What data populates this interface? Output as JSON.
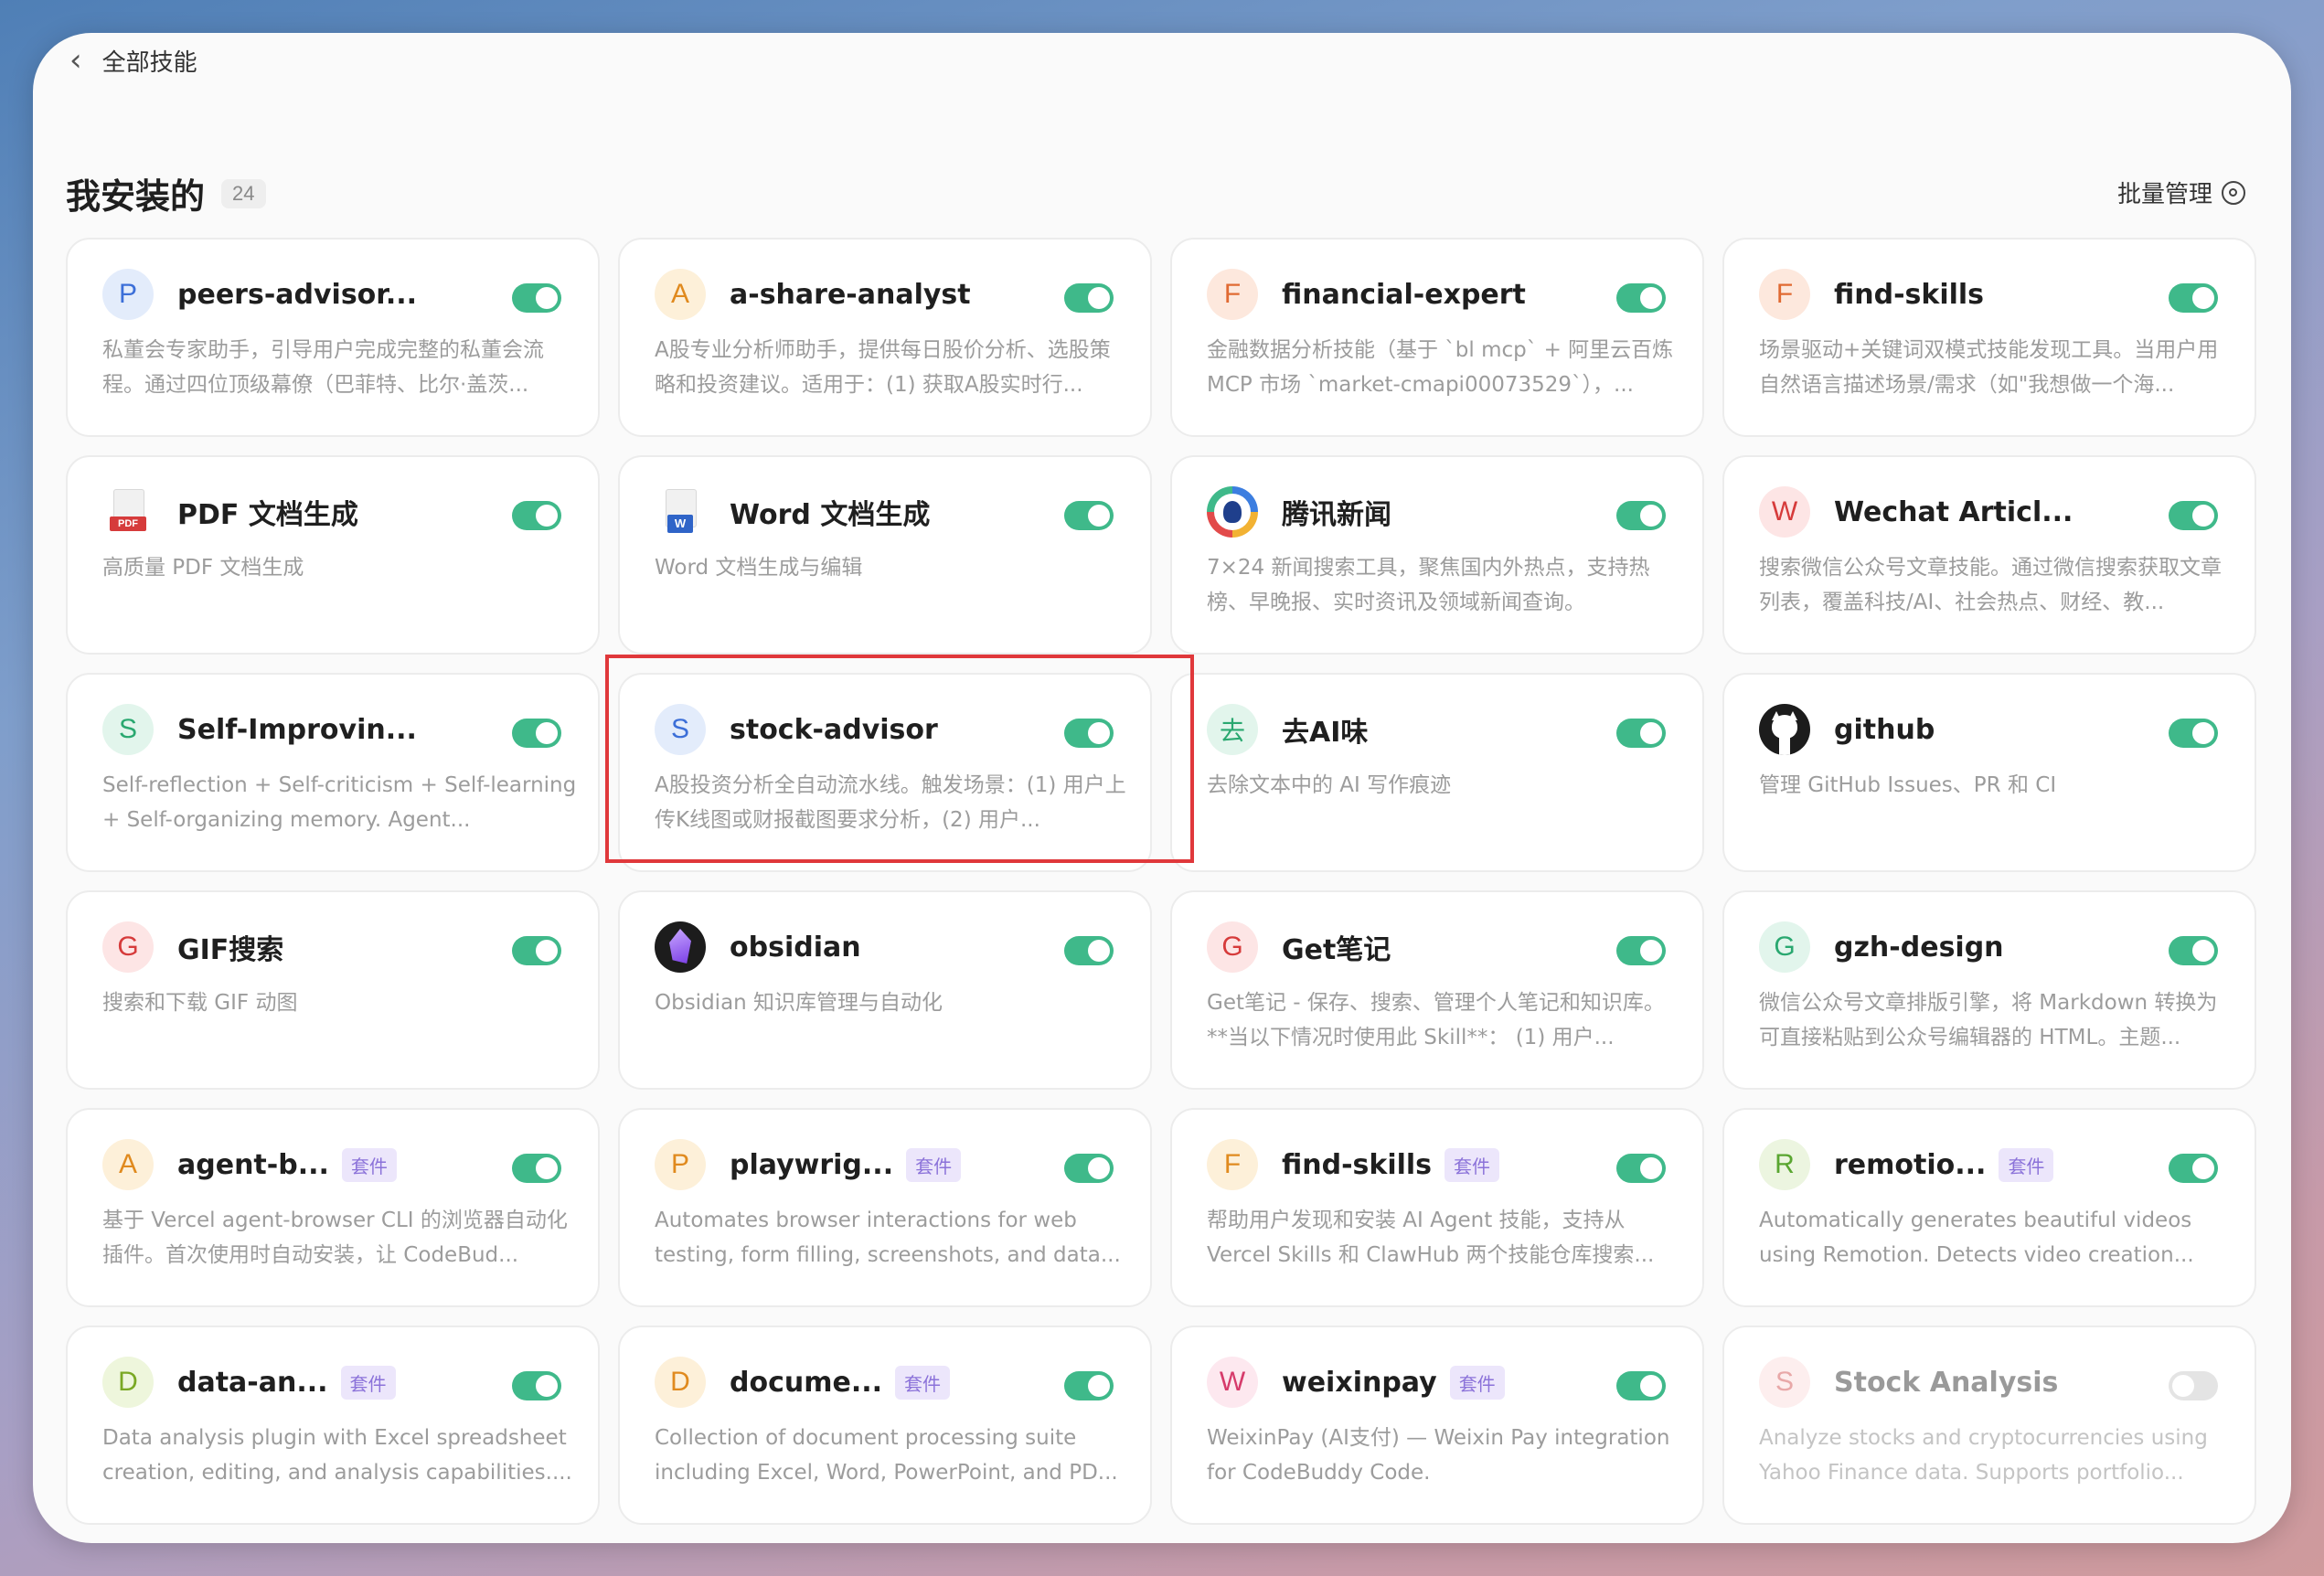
{
  "header": {
    "back_label": "全部技能",
    "section_title": "我安装的",
    "count": "24",
    "batch_label": "批量管理"
  },
  "colors": {
    "toggle_on": "#3fb98a",
    "toggle_off": "#e4e4e4",
    "kit_badge_bg": "#ece6fb",
    "kit_badge_text": "#8b72d9",
    "highlight": "#e0383b"
  },
  "kit_label": "套件",
  "skills": [
    {
      "name": "peers-advisor...",
      "icon": "P",
      "desc": "私董会专家助手，引导用户完成完整的私董会流程。通过四位顶级幕僚（巴菲特、比尔·盖茨...",
      "enabled": true
    },
    {
      "name": "a-share-analyst",
      "icon": "A",
      "desc": "A股专业分析师助手，提供每日股价分析、选股策略和投资建议。适用于：(1) 获取A股实时行...",
      "enabled": true
    },
    {
      "name": "financial-expert",
      "icon": "F",
      "desc": "金融数据分析技能（基于 `bl mcp` + 阿里云百炼 MCP 市场 `market-cmapi00073529`），...",
      "enabled": true
    },
    {
      "name": "find-skills",
      "icon": "F",
      "desc": "场景驱动+关键词双模式技能发现工具。当用户用自然语言描述场景/需求（如\"我想做一个海...",
      "enabled": true
    },
    {
      "name": "PDF 文档生成",
      "icon": "pdf-icon",
      "icon_text": "PDF",
      "desc": "高质量 PDF 文档生成",
      "enabled": true
    },
    {
      "name": "Word 文档生成",
      "icon": "word-icon",
      "icon_text": "W",
      "desc": "Word 文档生成与编辑",
      "enabled": true
    },
    {
      "name": "腾讯新闻",
      "icon": "tencent-news-icon",
      "desc": "7×24 新闻搜索工具，聚焦国内外热点，支持热榜、早晚报、实时资讯及领域新闻查询。",
      "enabled": true
    },
    {
      "name": "Wechat Articl...",
      "icon": "W",
      "desc": "搜索微信公众号文章技能。通过微信搜索获取文章列表，覆盖科技/AI、社会热点、财经、教...",
      "enabled": true
    },
    {
      "name": "Self-Improvin...",
      "icon": "S",
      "desc": "Self-reflection + Self-criticism + Self-learning + Self-organizing memory. Agent...",
      "enabled": true
    },
    {
      "name": "stock-advisor",
      "icon": "S",
      "desc": "A股投资分析全自动流水线。触发场景：(1) 用户上传K线图或财报截图要求分析，(2) 用户...",
      "enabled": true
    },
    {
      "name": "去AI味",
      "icon": "去",
      "desc": "去除文本中的 AI 写作痕迹",
      "enabled": true
    },
    {
      "name": "github",
      "icon": "github-icon",
      "desc": "管理 GitHub Issues、PR 和 CI",
      "enabled": true
    },
    {
      "name": "GIF搜索",
      "icon": "G",
      "desc": "搜索和下载 GIF 动图",
      "enabled": true
    },
    {
      "name": "obsidian",
      "icon": "obsidian-icon",
      "desc": "Obsidian 知识库管理与自动化",
      "enabled": true
    },
    {
      "name": "Get笔记",
      "icon": "G",
      "desc": "Get笔记 - 保存、搜索、管理个人笔记和知识库。 **当以下情况时使用此 Skill**： (1) 用户...",
      "enabled": true
    },
    {
      "name": "gzh-design",
      "icon": "G",
      "desc": "微信公众号文章排版引擎，将 Markdown 转换为可直接粘贴到公众号编辑器的 HTML。主题...",
      "enabled": true
    },
    {
      "name": "agent-b...",
      "icon": "A",
      "kit": true,
      "desc": "基于 Vercel agent-browser CLI 的浏览器自动化插件。首次使用时自动安装，让 CodeBud...",
      "enabled": true
    },
    {
      "name": "playwrig...",
      "icon": "P",
      "kit": true,
      "desc": "Automates browser interactions for web testing, form filling, screenshots, and data...",
      "enabled": true
    },
    {
      "name": "find-skills",
      "icon": "F",
      "kit": true,
      "desc": "帮助用户发现和安装 AI Agent 技能，支持从 Vercel Skills 和 ClawHub 两个技能仓库搜索...",
      "enabled": true
    },
    {
      "name": "remotio...",
      "icon": "R",
      "kit": true,
      "desc": "Automatically generates beautiful videos using Remotion. Detects video creation...",
      "enabled": true
    },
    {
      "name": "data-an...",
      "icon": "D",
      "kit": true,
      "desc": "Data analysis plugin with Excel spreadsheet creation, editing, and analysis capabilities....",
      "enabled": true
    },
    {
      "name": "docume...",
      "icon": "D",
      "kit": true,
      "desc": "Collection of document processing suite including Excel, Word, PowerPoint, and PD...",
      "enabled": true
    },
    {
      "name": "weixinpay",
      "icon": "W",
      "kit": true,
      "desc": "WeixinPay (AI支付) — Weixin Pay integration for CodeBuddy Code.",
      "enabled": true
    },
    {
      "name": "Stock Analysis",
      "icon": "S",
      "desc": "Analyze stocks and cryptocurrencies using Yahoo Finance data. Supports portfolio...",
      "enabled": false
    }
  ]
}
